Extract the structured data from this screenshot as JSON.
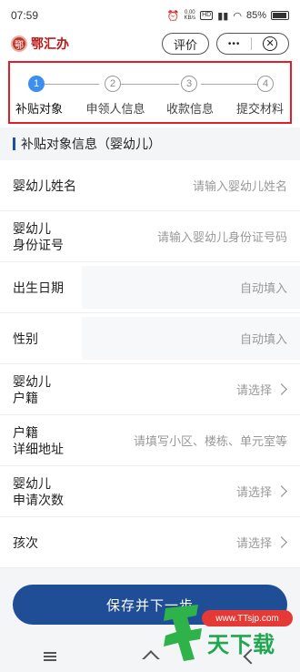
{
  "status_bar": {
    "time": "07:59",
    "net_speed_value": "0.00",
    "net_speed_unit": "KB/s",
    "network_badge": "HD",
    "battery": "85%"
  },
  "header": {
    "app_name": "鄂汇办",
    "review_label": "评价",
    "more_label": "•••",
    "close_label": "✕"
  },
  "stepper": {
    "steps": [
      {
        "number": "1",
        "label": "补贴对象"
      },
      {
        "number": "2",
        "label": "申领人信息"
      },
      {
        "number": "3",
        "label": "收款信息"
      },
      {
        "number": "4",
        "label": "提交材料"
      }
    ],
    "active_step": 1,
    "accent": "#3a8ff0",
    "highlight_border": "#e21d2a"
  },
  "section": {
    "title": "补贴对象信息（婴幼儿）"
  },
  "form": {
    "rows": [
      {
        "label_line1": "婴幼儿姓名",
        "label_line2": "",
        "value": "请输入婴幼儿姓名"
      },
      {
        "label_line1": "婴幼儿",
        "label_line2": "身份证号",
        "value": "请输入婴幼儿身份证号码"
      },
      {
        "label_line1": "出生日期",
        "label_line2": "",
        "value": "自动填入"
      },
      {
        "label_line1": "性别",
        "label_line2": "",
        "value": "自动填入"
      },
      {
        "label_line1": "婴幼儿",
        "label_line2": "户籍",
        "value": "请选择"
      },
      {
        "label_line1": "户籍",
        "label_line2": "详细地址",
        "value": "请填写小区、楼栋、单元室等"
      },
      {
        "label_line1": "婴幼儿",
        "label_line2": "申请次数",
        "value": "请选择"
      },
      {
        "label_line1": "孩次",
        "label_line2": "",
        "value": "请选择"
      }
    ]
  },
  "footer": {
    "save_label": "保存并下一步",
    "primary_color": "#1f4e96"
  },
  "watermark": {
    "url": "www.TTsjp.com",
    "text": "天下载"
  }
}
